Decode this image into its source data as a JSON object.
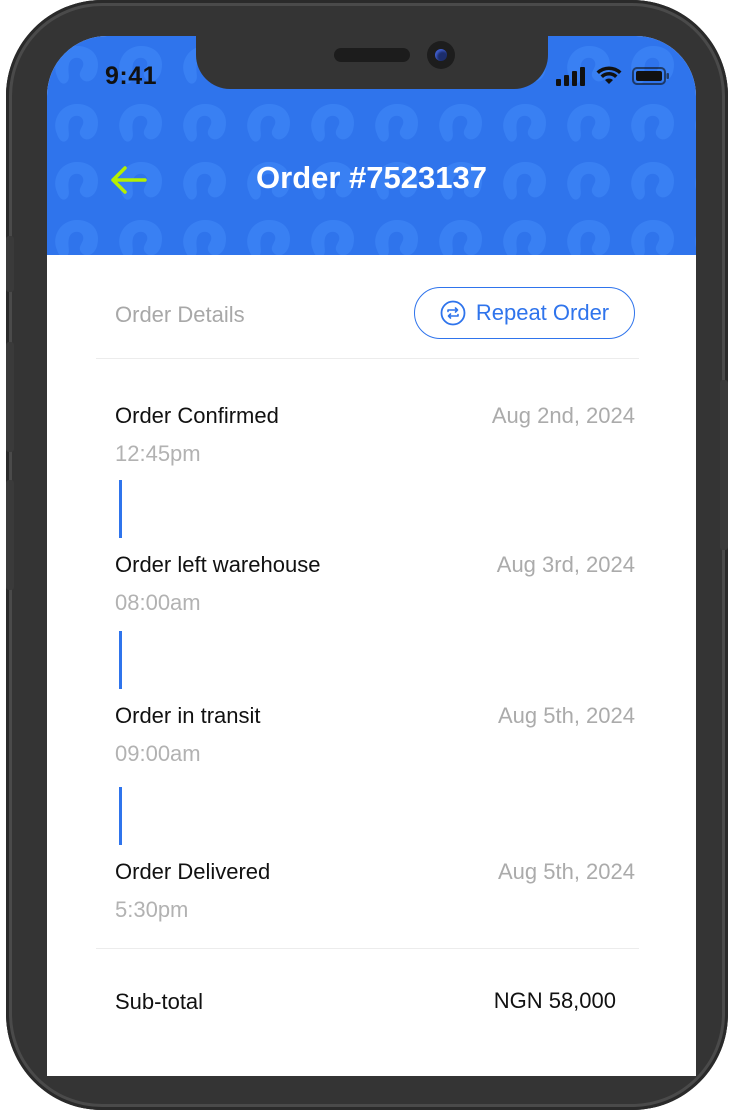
{
  "status_bar": {
    "time": "9:41",
    "icons": [
      "cellular-signal-icon",
      "wifi-icon",
      "battery-icon"
    ]
  },
  "header": {
    "back_icon": "arrow-left-icon",
    "title": "Order #7523137"
  },
  "details": {
    "section_label": "Order Details",
    "repeat_button": {
      "icon": "repeat-icon",
      "label": "Repeat Order"
    }
  },
  "timeline": [
    {
      "title": "Order Confirmed",
      "time": "12:45pm",
      "date": "Aug 2nd, 2024"
    },
    {
      "title": "Order left warehouse",
      "time": "08:00am",
      "date": "Aug 3rd, 2024"
    },
    {
      "title": "Order in transit",
      "time": "09:00am",
      "date": "Aug 5th, 2024"
    },
    {
      "title": "Order Delivered",
      "time": "5:30pm",
      "date": "Aug 5th, 2024"
    }
  ],
  "summary": {
    "subtotal_label": "Sub-total",
    "subtotal_value": "NGN 58,000"
  },
  "colors": {
    "primary": "#2F74EC",
    "back_arrow": "#B4F000",
    "muted_text": "#ABABAB",
    "text": "#111111"
  }
}
